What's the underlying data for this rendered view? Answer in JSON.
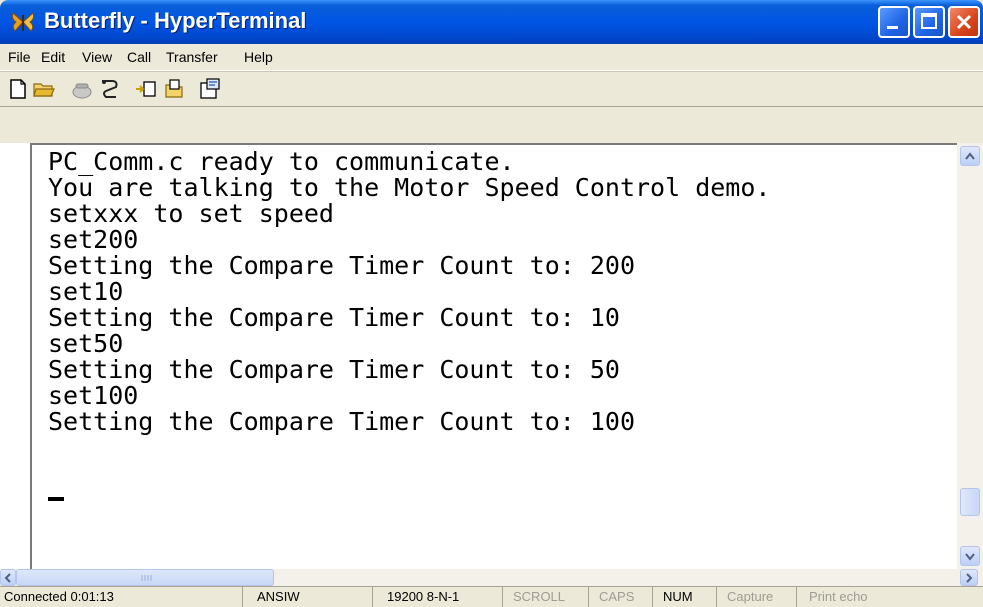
{
  "window": {
    "title": "Butterfly - HyperTerminal"
  },
  "menu": [
    "File",
    "Edit",
    "View",
    "Call",
    "Transfer",
    "Help"
  ],
  "toolbar": {
    "icons": [
      "new-connection-icon",
      "open-icon",
      "phone-icon",
      "disconnect-icon",
      "send-file-icon",
      "receive-file-icon",
      "properties-icon"
    ]
  },
  "terminal": {
    "lines": [
      "PC_Comm.c ready to communicate.",
      "You are talking to the Motor Speed Control demo.",
      "setxxx to set speed",
      "set200",
      "Setting the Compare Timer Count to: 200",
      "set10",
      "Setting the Compare Timer Count to: 10",
      "set50",
      "Setting the Compare Timer Count to: 50",
      "set100",
      "Setting the Compare Timer Count to: 100"
    ]
  },
  "status": {
    "connected": "Connected 0:01:13",
    "emulation": "ANSIW",
    "settings": "19200 8-N-1",
    "scroll": "SCROLL",
    "caps": "CAPS",
    "num": "NUM",
    "capture": "Capture",
    "print_echo": "Print echo"
  },
  "colors": {
    "title_bar": "#0055e5",
    "close_button": "#d8441b",
    "terminal_bg": "#ffffff",
    "chrome": "#ece9d8"
  }
}
